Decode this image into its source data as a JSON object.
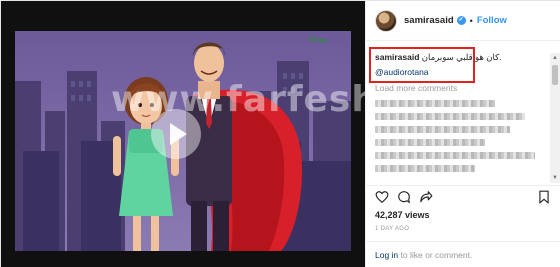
{
  "video": {
    "watermark_text": "www.farfesh.com",
    "brand_logo_text": "روتانا"
  },
  "header": {
    "username": "samirasaid",
    "verified_glyph": "✔",
    "separator": "•",
    "follow_label": "Follow"
  },
  "caption": {
    "username": "samirasaid",
    "text": "كان هو قلبي سوبرمان.",
    "mention": "@audiorotana"
  },
  "comments": {
    "load_more_label": "Load more comments"
  },
  "scrollbar": {
    "up_glyph": "▲",
    "down_glyph": "▼"
  },
  "actions": {
    "icons": [
      "heart-icon",
      "comment-icon",
      "share-icon",
      "bookmark-icon"
    ]
  },
  "stats": {
    "views": "42,287 views",
    "time_ago": "1 DAY AGO"
  },
  "login": {
    "link_label": "Log in",
    "rest_text": " to like or comment."
  },
  "colors": {
    "accent": "#3897f0",
    "highlight_border": "#e0231f",
    "cape": "#d8202a",
    "dress": "#5fd4a0",
    "sky": "#5a4e8a"
  }
}
